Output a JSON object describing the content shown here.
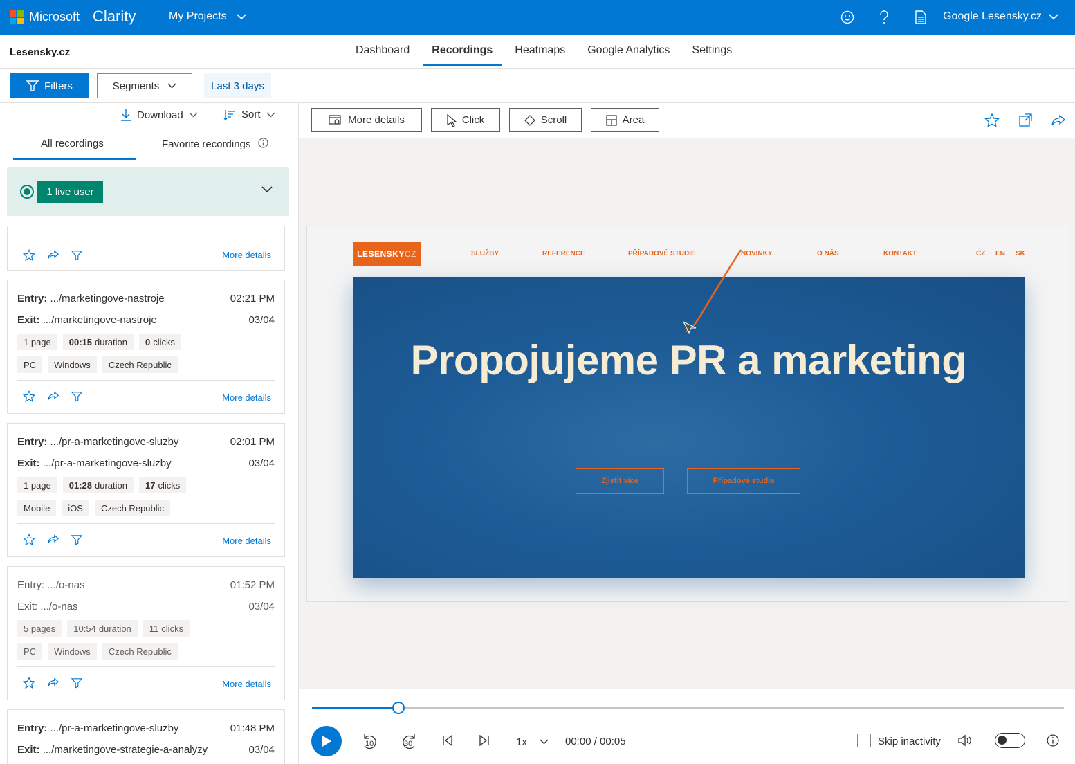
{
  "topbar": {
    "brand_ms": "Microsoft",
    "brand_product": "Clarity",
    "projects_label": "My Projects",
    "account_label": "Google Lesensky.cz",
    "color": "#0078d4"
  },
  "header": {
    "site_name": "Lesensky.cz",
    "tabs": [
      {
        "label": "Dashboard"
      },
      {
        "label": "Recordings"
      },
      {
        "label": "Heatmaps"
      },
      {
        "label": "Google Analytics"
      },
      {
        "label": "Settings"
      }
    ],
    "active_tab": "Recordings"
  },
  "filters": {
    "filters_label": "Filters",
    "segments_label": "Segments",
    "range_label": "Last 3 days"
  },
  "left": {
    "download_label": "Download",
    "sort_label": "Sort",
    "tab_all": "All recordings",
    "tab_fav": "Favorite recordings",
    "live_label": "1 live user",
    "more_details": "More details",
    "cards": [
      {
        "entry_label": "Entry:",
        "entry": ".../marketingove-nastroje",
        "time": "02:21 PM",
        "exit_label": "Exit:",
        "exit": ".../marketingove-nastroje",
        "date": "03/04",
        "pages": "1 page",
        "duration_v": "00:15",
        "duration_t": "duration",
        "clicks_v": "0",
        "clicks_t": "clicks",
        "device": "PC",
        "os": "Windows",
        "country": "Czech Republic"
      },
      {
        "entry_label": "Entry:",
        "entry": ".../pr-a-marketingove-sluzby",
        "time": "02:01 PM",
        "exit_label": "Exit:",
        "exit": ".../pr-a-marketingove-sluzby",
        "date": "03/04",
        "pages": "1 page",
        "duration_v": "01:28",
        "duration_t": "duration",
        "clicks_v": "17",
        "clicks_t": "clicks",
        "device": "Mobile",
        "os": "iOS",
        "country": "Czech Republic"
      },
      {
        "entry_label": "Entry:",
        "entry": ".../o-nas",
        "time": "01:52 PM",
        "exit_label": "Exit:",
        "exit": ".../o-nas",
        "date": "03/04",
        "pages": "5 pages",
        "duration_v": "10:54",
        "duration_t": "duration",
        "clicks_v": "11",
        "clicks_t": "clicks",
        "device": "PC",
        "os": "Windows",
        "country": "Czech Republic"
      },
      {
        "entry_label": "Entry:",
        "entry": ".../pr-a-marketingove-sluzby",
        "time": "01:48 PM",
        "exit_label": "Exit:",
        "exit": ".../marketingove-strategie-a-analyzy",
        "date": "03/04"
      }
    ]
  },
  "toolbar": {
    "more_details": "More details",
    "click": "Click",
    "scroll": "Scroll",
    "area": "Area"
  },
  "site_preview": {
    "logo_main": "LESENSKY",
    "logo_sub": "CZ",
    "nav": [
      "SLUŽBY",
      "REFERENCE",
      "PŘÍPADOVÉ STUDIE",
      "NOVINKY",
      "O NÁS",
      "KONTAKT"
    ],
    "lang": [
      "CZ",
      "EN",
      "SK"
    ],
    "hero_title": "Propojujeme PR a marketing",
    "hero_btn1": "Zjistit více",
    "hero_btn2": "Případové studie",
    "accent": "#e8641b",
    "hero_color": "#1d5b96"
  },
  "player": {
    "progress": 0.115,
    "back_seconds": "10",
    "fwd_seconds": "30",
    "speed": "1x",
    "time": "00:00 / 00:05",
    "skip_label": "Skip inactivity"
  }
}
